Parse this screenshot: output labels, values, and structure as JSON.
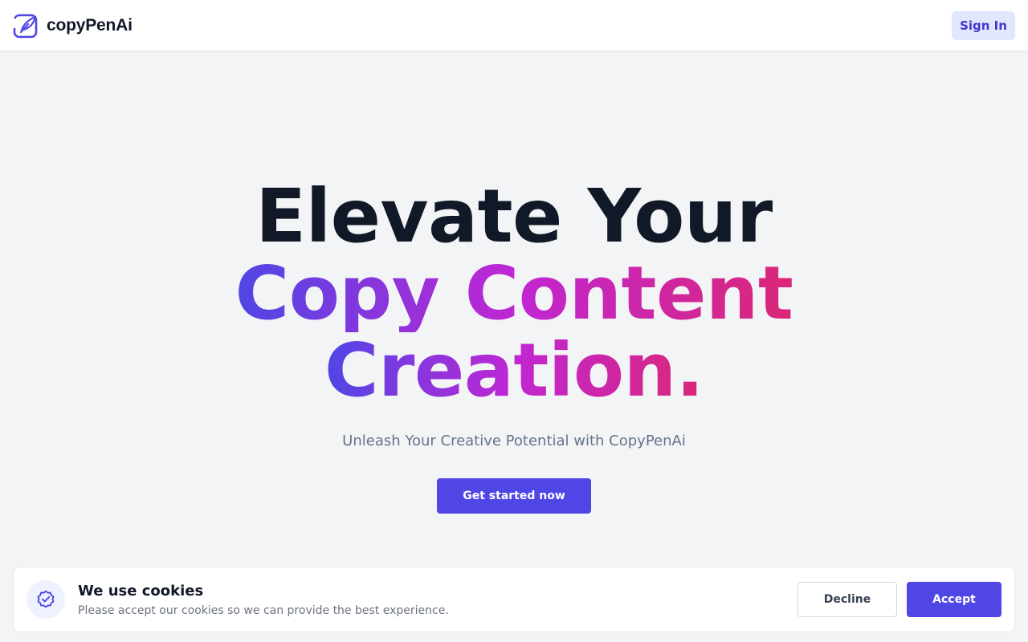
{
  "header": {
    "brand_name": "copyPenAi",
    "logo_icon": "quill-pen-icon",
    "signin_label": "Sign In"
  },
  "hero": {
    "title_line1": "Elevate Your",
    "title_line2": "Copy Content",
    "title_line3": "Creation.",
    "subtitle": "Unleash Your Creative Potential with CopyPenAi",
    "cta_label": "Get started now"
  },
  "cookie_banner": {
    "icon": "badge-check-icon",
    "title": "We use cookies",
    "text": "Please accept our cookies so we can provide the best experience.",
    "decline_label": "Decline",
    "accept_label": "Accept"
  },
  "colors": {
    "accent": "#4f46e5",
    "signin_bg": "#e0e7ff",
    "gradient_start": "#4f46e5",
    "gradient_mid": "#c026d3",
    "gradient_end": "#db2777",
    "page_bg": "#f3f4f6"
  }
}
